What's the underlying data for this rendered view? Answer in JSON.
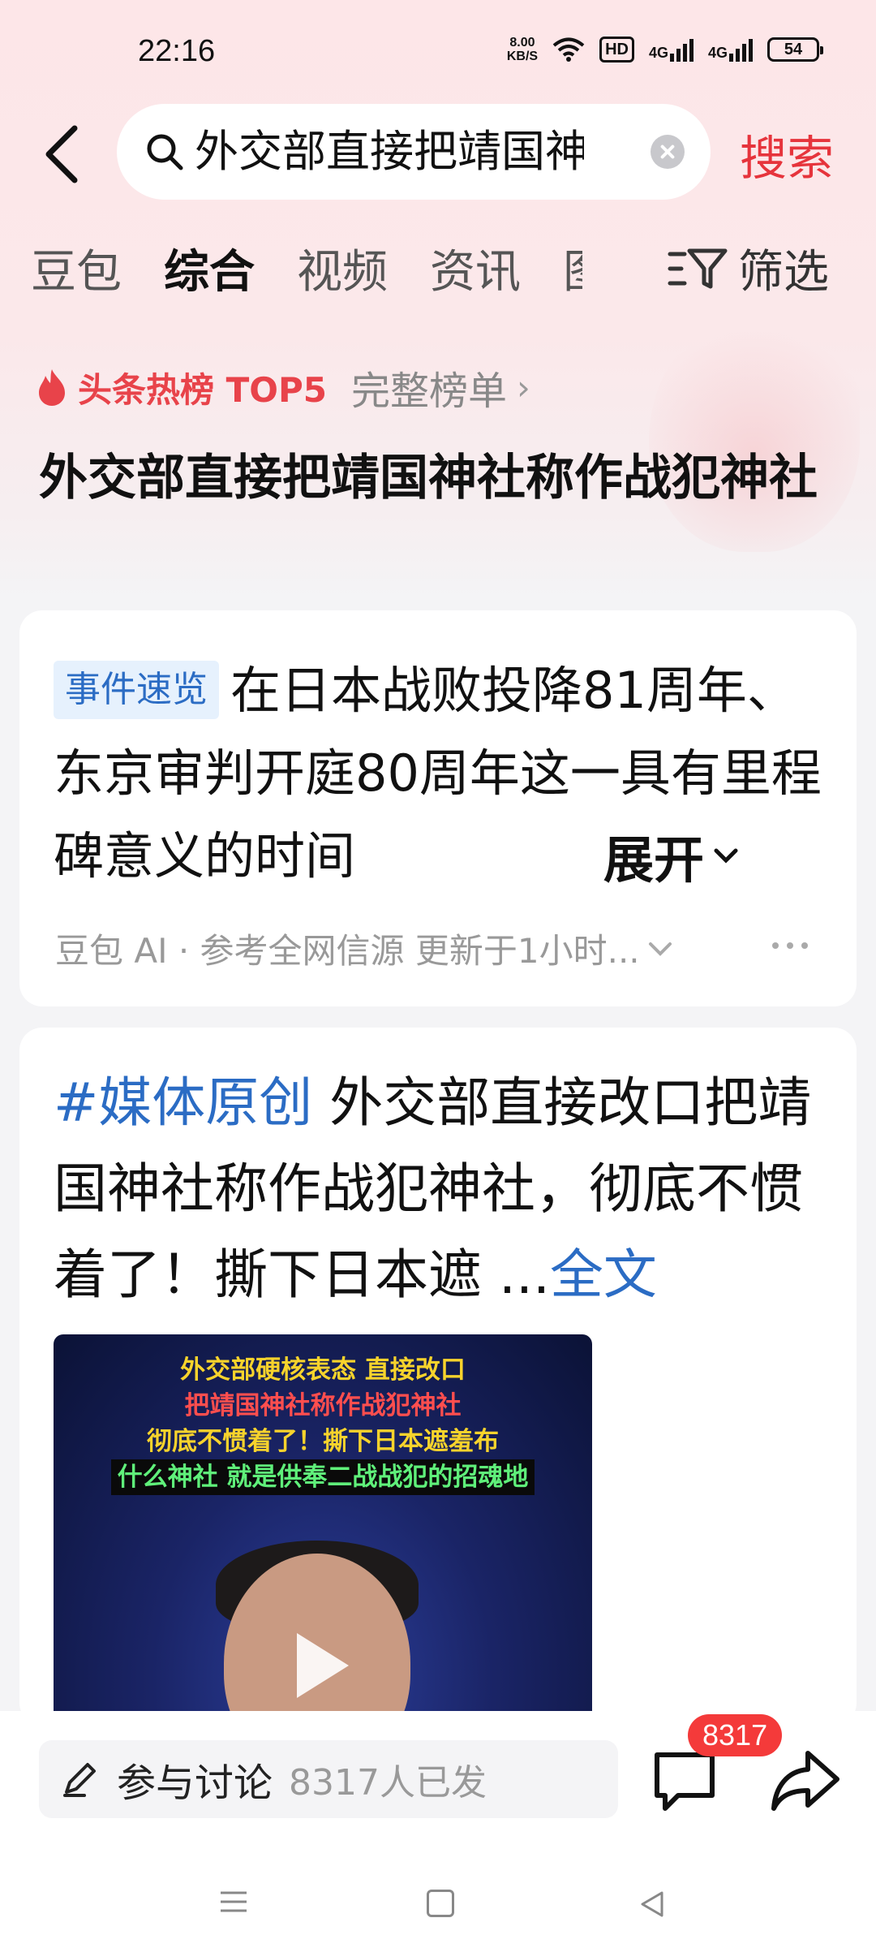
{
  "status_bar": {
    "time": "22:16",
    "net_speed_value": "8.00",
    "net_speed_unit": "KB/S",
    "hd_label": "HD",
    "signal1_label": "4G",
    "signal2_label": "4G",
    "battery": "54"
  },
  "search": {
    "query": "外交部直接把靖国神社称作战犯神社",
    "button_label": "搜索"
  },
  "tabs": [
    {
      "label": "豆包"
    },
    {
      "label": "综合",
      "active": true
    },
    {
      "label": "视频"
    },
    {
      "label": "资讯"
    },
    {
      "label": "图"
    }
  ],
  "filter": {
    "label": "筛选"
  },
  "hot_list": {
    "title": "头条热榜 TOP5",
    "full_link": "完整榜单",
    "chevron": "›"
  },
  "page_title": "外交部直接把靖国神社称作战犯神社",
  "summary_card": {
    "tag": "事件速览",
    "text": "在日本战败投降81周年、东京审判开庭80周年这一具有里程碑意义的时间",
    "expand_label": "展开",
    "meta": "豆包 AI · 参考全网信源 更新于1小时..."
  },
  "post_card": {
    "tag": "#媒体原创",
    "text": " 外交部直接改口把靖国神社称作战犯神社，彻底不惯着了！撕下日本遮 ...",
    "full_link": "全文",
    "video_caption": [
      "外交部硬核表态 直接改口",
      "把靖国神社称作战犯神社",
      "彻底不惯着了！撕下日本遮羞布",
      "什么神社 就是供奉二战战犯的招魂地"
    ]
  },
  "bottom_bar": {
    "discuss_label": "参与讨论",
    "discuss_count": "8317人已发",
    "comment_badge": "8317"
  },
  "colors": {
    "accent_red": "#e6343c",
    "link_blue": "#2b6cc4",
    "header_pink": "#fde6e8"
  }
}
